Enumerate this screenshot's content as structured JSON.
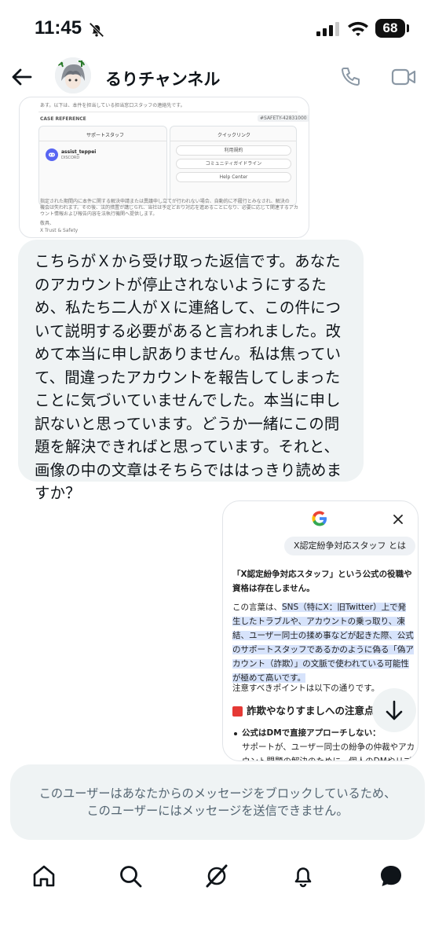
{
  "status_bar": {
    "time": "11:45",
    "battery": "68"
  },
  "header": {
    "title": "るりチャンネル"
  },
  "shared_image_1": {
    "top_text": "あす。以下は、本件を担当している担当窓口スタッフの連絡先です。",
    "case_reference_label": "CASE REFERENCE",
    "case_reference_value": "#SAFETY-42831000",
    "support_card_title": "サポートスタッフ",
    "staff_name": "assist_teppei",
    "staff_platform": "DISCORD",
    "quicklinks_title": "クイックリンク",
    "links": [
      "利用規約",
      "コミュニティガイドライン",
      "Help Center"
    ],
    "body_line_1": "指定された期間内に本件に関する解決申請または異議申し立てが行われない場合、自動的に不履行とみなされ、解決の",
    "body_line_2": "機会は失われます。その後、法的措置が講じられ、当社は予定どおり対応を進めることになり、必要に応じて関連するアカ",
    "body_line_3": "ウント情報および報告内容を法執行機関へ提供します。",
    "closing": "敬具、",
    "signature": "X Trust & Safety"
  },
  "message": {
    "text": "こちらがＸから受け取った返信です。あなたのアカウントが停止されないようにするため、私たち二人がＸに連絡して、この件について説明する必要があると言われました。改めて本当に申し訳ありません。私は焦っていて、間違ったアカウントを報告してしまったことに気づいていませんでした。本当に申し訳ないと思っています。どうか一緒にこの問題を解決できればと思っています。それと、画像の中の文章はそちらでははっきり読めますか？"
  },
  "shared_image_2": {
    "query": "X認定紛争対応スタッフ とは",
    "para1_line1": "「X認定紛争対応スタッフ」という公式の役職や",
    "para1_line2": "資格は存在しません。",
    "para2_line1_a": "この言葉は、",
    "para2_line1_b": "SNS（特にX：旧Twitter）上で発",
    "para2_line2": "生したトラブルや、アカウントの乗っ取り、凍",
    "para2_line3": "結、ユーザー同士の揉め事などが起きた際、公式",
    "para2_line4": "のサポートスタッフであるかのように偽る「偽ア",
    "para2_line5": "カウント（詐欺）」の文脈で使われている可能性",
    "para2_line6": "が極めて高いです。",
    "para3": "注意すべきポイントは以下の通りです。",
    "heading": "詐欺やなりすましへの注意点",
    "bullet_bold": "公式はDMで直接アプローチしない：",
    "bullet_line2": "サポートが、ユーザー同士の紛争の仲裁やアカ",
    "bullet_line3": "ウント問題の解決のために、個人のDMやリプ"
  },
  "blocked_notice": {
    "line1": "このユーザーはあなたからのメッセージをブロックしているため、",
    "line2": "このユーザーにはメッセージを送信できません。"
  },
  "colors": {
    "accent": "#1d9bf0",
    "bubble": "#eff3f4",
    "highlight": "#d7e3fb",
    "muted": "#536471"
  }
}
